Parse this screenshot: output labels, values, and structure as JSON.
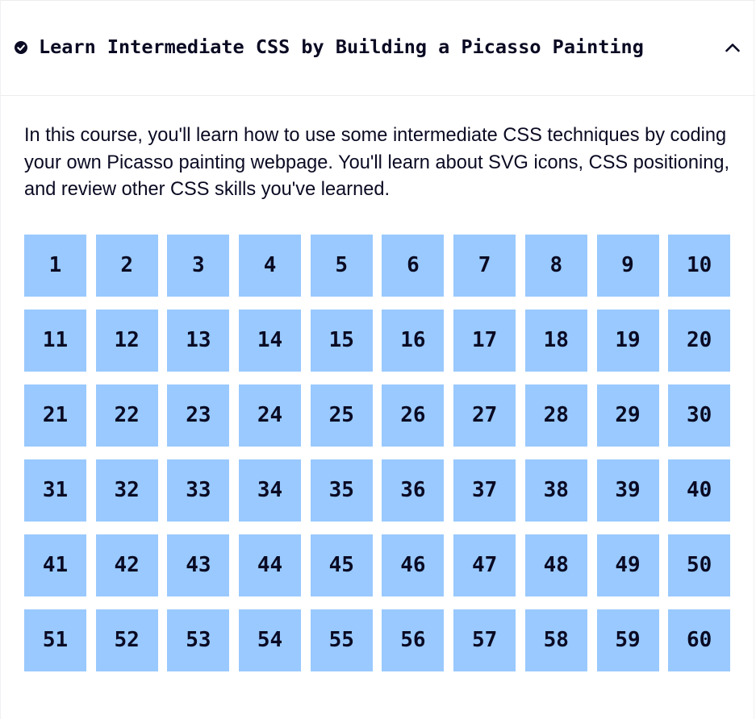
{
  "block": {
    "title": "Learn Intermediate CSS by Building a Picasso Painting",
    "completed_icon": "check-circle-icon",
    "toggle_icon": "caret-up-icon",
    "description": "In this course, you'll learn how to use some intermediate CSS techniques by coding your own Picasso painting webpage. You'll learn about SVG icons, CSS positioning, and review other CSS skills you've learned."
  },
  "steps": [
    "1",
    "2",
    "3",
    "4",
    "5",
    "6",
    "7",
    "8",
    "9",
    "10",
    "11",
    "12",
    "13",
    "14",
    "15",
    "16",
    "17",
    "18",
    "19",
    "20",
    "21",
    "22",
    "23",
    "24",
    "25",
    "26",
    "27",
    "28",
    "29",
    "30",
    "31",
    "32",
    "33",
    "34",
    "35",
    "36",
    "37",
    "38",
    "39",
    "40",
    "41",
    "42",
    "43",
    "44",
    "45",
    "46",
    "47",
    "48",
    "49",
    "50",
    "51",
    "52",
    "53",
    "54",
    "55",
    "56",
    "57",
    "58",
    "59",
    "60"
  ],
  "colors": {
    "step_background": "#99c9ff",
    "text": "#0a0a23",
    "background": "#ffffff",
    "divider": "#ededf0"
  }
}
